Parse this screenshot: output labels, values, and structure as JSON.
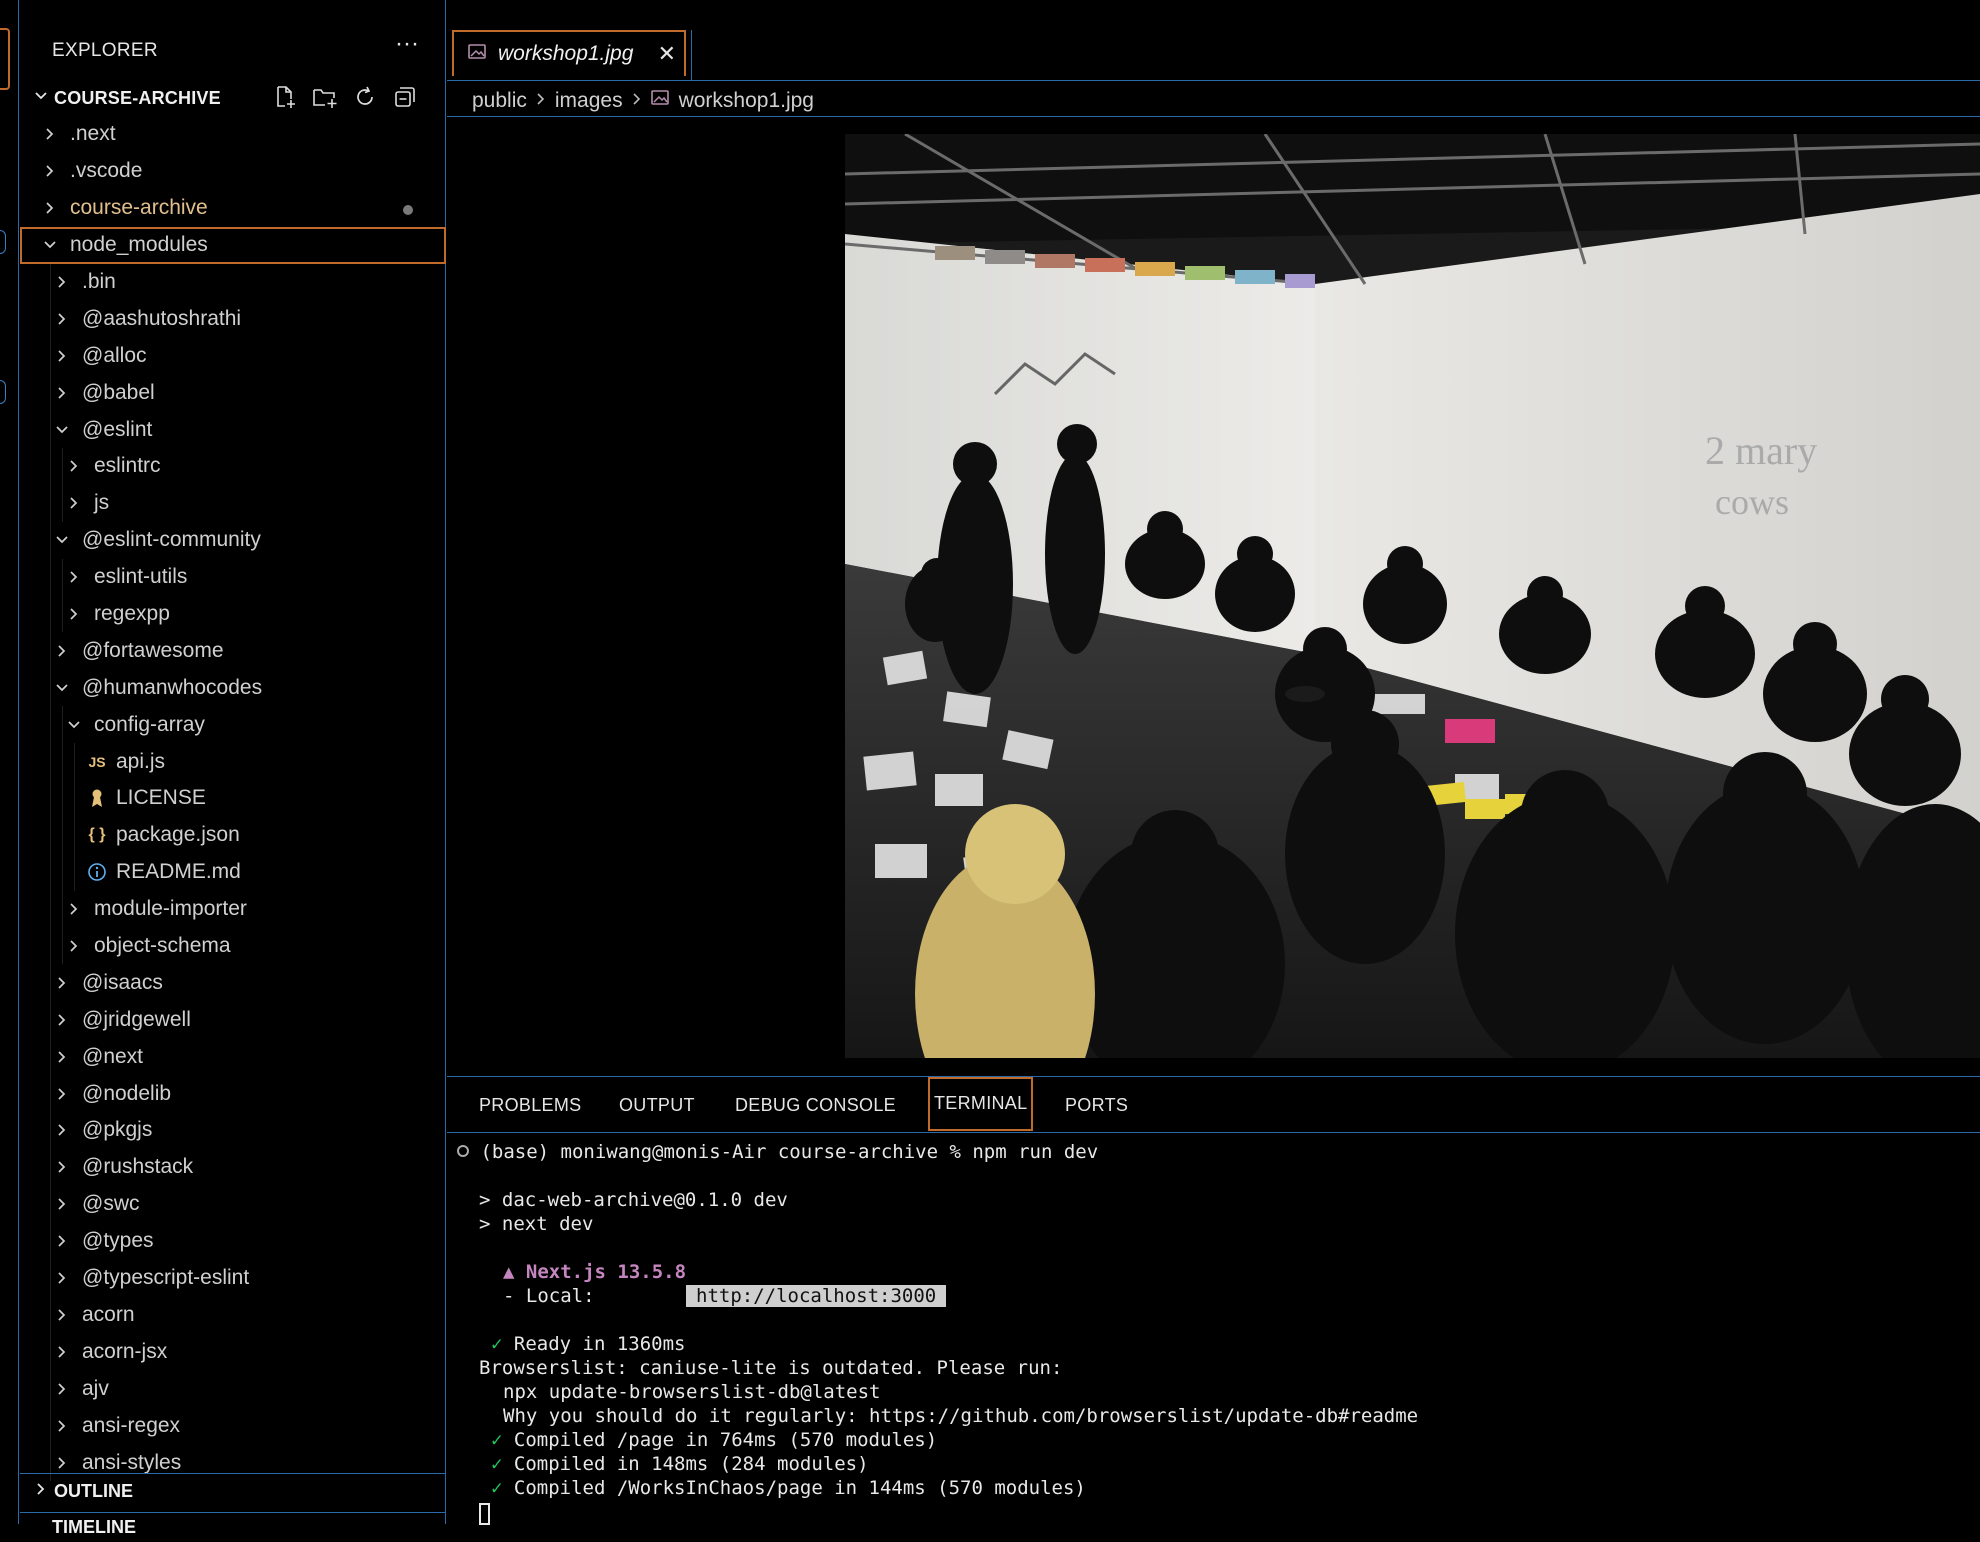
{
  "explorer": {
    "title": "EXPLORER",
    "more": "···",
    "workspace": "COURSE-ARCHIVE",
    "items": [
      {
        "label": ".next",
        "kind": "folder",
        "depth": 0,
        "open": false
      },
      {
        "label": ".vscode",
        "kind": "folder",
        "depth": 0,
        "open": false
      },
      {
        "label": "course-archive",
        "kind": "folder",
        "depth": 0,
        "open": false,
        "modified": true
      },
      {
        "label": "node_modules",
        "kind": "folder",
        "depth": 0,
        "open": true,
        "selected": true
      },
      {
        "label": ".bin",
        "kind": "folder",
        "depth": 1,
        "open": false
      },
      {
        "label": "@aashutoshrathi",
        "kind": "folder",
        "depth": 1,
        "open": false
      },
      {
        "label": "@alloc",
        "kind": "folder",
        "depth": 1,
        "open": false
      },
      {
        "label": "@babel",
        "kind": "folder",
        "depth": 1,
        "open": false
      },
      {
        "label": "@eslint",
        "kind": "folder",
        "depth": 1,
        "open": true
      },
      {
        "label": "eslintrc",
        "kind": "folder",
        "depth": 2,
        "open": false
      },
      {
        "label": "js",
        "kind": "folder",
        "depth": 2,
        "open": false
      },
      {
        "label": "@eslint-community",
        "kind": "folder",
        "depth": 1,
        "open": true
      },
      {
        "label": "eslint-utils",
        "kind": "folder",
        "depth": 2,
        "open": false
      },
      {
        "label": "regexpp",
        "kind": "folder",
        "depth": 2,
        "open": false
      },
      {
        "label": "@fortawesome",
        "kind": "folder",
        "depth": 1,
        "open": false
      },
      {
        "label": "@humanwhocodes",
        "kind": "folder",
        "depth": 1,
        "open": true
      },
      {
        "label": "config-array",
        "kind": "folder",
        "depth": 2,
        "open": true
      },
      {
        "label": "api.js",
        "kind": "file",
        "icon": "js",
        "depth": 3
      },
      {
        "label": "LICENSE",
        "kind": "file",
        "icon": "license",
        "depth": 3
      },
      {
        "label": "package.json",
        "kind": "file",
        "icon": "json",
        "depth": 3
      },
      {
        "label": "README.md",
        "kind": "file",
        "icon": "info",
        "depth": 3
      },
      {
        "label": "module-importer",
        "kind": "folder",
        "depth": 2,
        "open": false
      },
      {
        "label": "object-schema",
        "kind": "folder",
        "depth": 2,
        "open": false
      },
      {
        "label": "@isaacs",
        "kind": "folder",
        "depth": 1,
        "open": false
      },
      {
        "label": "@jridgewell",
        "kind": "folder",
        "depth": 1,
        "open": false
      },
      {
        "label": "@next",
        "kind": "folder",
        "depth": 1,
        "open": false
      },
      {
        "label": "@nodelib",
        "kind": "folder",
        "depth": 1,
        "open": false
      },
      {
        "label": "@pkgjs",
        "kind": "folder",
        "depth": 1,
        "open": false
      },
      {
        "label": "@rushstack",
        "kind": "folder",
        "depth": 1,
        "open": false
      },
      {
        "label": "@swc",
        "kind": "folder",
        "depth": 1,
        "open": false
      },
      {
        "label": "@types",
        "kind": "folder",
        "depth": 1,
        "open": false
      },
      {
        "label": "@typescript-eslint",
        "kind": "folder",
        "depth": 1,
        "open": false
      },
      {
        "label": "acorn",
        "kind": "folder",
        "depth": 1,
        "open": false
      },
      {
        "label": "acorn-jsx",
        "kind": "folder",
        "depth": 1,
        "open": false
      },
      {
        "label": "ajv",
        "kind": "folder",
        "depth": 1,
        "open": false
      },
      {
        "label": "ansi-regex",
        "kind": "folder",
        "depth": 1,
        "open": false
      },
      {
        "label": "ansi-styles",
        "kind": "folder",
        "depth": 1,
        "open": false
      }
    ],
    "outline": "OUTLINE",
    "timeline": "TIMELINE"
  },
  "editor": {
    "tab_label": "workshop1.jpg",
    "tab_close": "✕",
    "breadcrumb": [
      "public",
      "images",
      "workshop1.jpg"
    ]
  },
  "panel": {
    "tabs": [
      "PROBLEMS",
      "OUTPUT",
      "DEBUG CONSOLE",
      "TERMINAL",
      "PORTS"
    ],
    "active_tab": "TERMINAL",
    "terminal": {
      "prompt": "(base) moniwang@monis-Air course-archive % npm run dev",
      "script_line1": "> dac-web-archive@0.1.0 dev",
      "script_line2": "> next dev",
      "next_version": "▲ Next.js 13.5.8",
      "local_label": "- Local:",
      "local_url": "http://localhost:3000",
      "ready": "Ready in 1360ms",
      "browserslist": "Browserslist: caniuse-lite is outdated. Please run:",
      "npx": "npx update-browserslist-db@latest",
      "why": "Why you should do it regularly: https://github.com/browserslist/update-db#readme",
      "compiled": [
        "Compiled /page in 764ms (570 modules)",
        "Compiled in 148ms (284 modules)",
        "Compiled /WorksInChaos/page in 144ms (570 modules)"
      ],
      "check_glyph": "✓"
    }
  },
  "colors": {
    "accent_border": "#c06a2b",
    "panel_border": "#2b6aa8",
    "modified_text": "#e2c08d",
    "js_icon": "#e5c07b",
    "json_icon": "#e5c07b",
    "info_icon": "#61afef",
    "next_purple": "#c586c0",
    "check_green": "#22c55e"
  }
}
